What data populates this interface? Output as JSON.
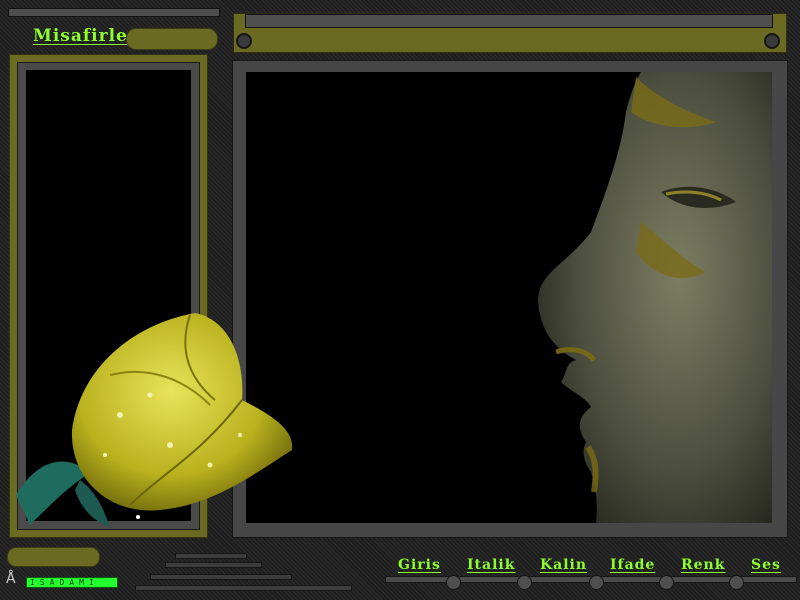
{
  "header": {
    "title": "Misafirler"
  },
  "nav": {
    "items": [
      {
        "label": "Giris"
      },
      {
        "label": "Italik"
      },
      {
        "label": "Kalin"
      },
      {
        "label": "Ifade"
      },
      {
        "label": "Renk"
      },
      {
        "label": "Ses"
      }
    ]
  },
  "branding": {
    "logo_text": "ISADAMI"
  },
  "colors": {
    "accent_green": "#8dff2a",
    "frame_olive": "#6b6a22",
    "logo_green": "#24ff30"
  },
  "icons": {
    "logo": "figure-a-icon",
    "flower": "yellow-rose-image",
    "portrait": "face-profile-image"
  }
}
